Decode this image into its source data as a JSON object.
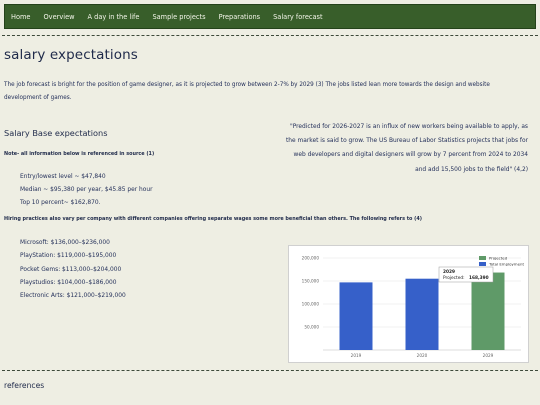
{
  "nav": {
    "items": [
      "Home",
      "Overview",
      "A day in the life",
      "Sample projects",
      "Preparations",
      "Salary forecast"
    ]
  },
  "page": {
    "title": "salary expectations",
    "intro": "The job forecast is bright for the position of game designer, as it is projected to grow between 2-7% by 2029 (3) The jobs listed lean more towards the design and website development of games."
  },
  "base": {
    "heading": "Salary Base expectations",
    "note": "Note- all information below is referenced in source (1)",
    "items": [
      "Entry/lowest level ~ $47,840",
      "Median ~ $95,380 per year, $45.85 per hour",
      "Top 10 percent~ $162,870."
    ]
  },
  "quote": "\"Predicted for 2026-2027 is an influx of new workers being available to apply, as the market is said to grow. The US Bureau of Labor Statistics projects that jobs for web developers and digital designers will grow by 7 percent from 2024 to 2034 and add 15,500 jobs to the field\" (4,2)",
  "hiring": {
    "text": "Hiring practices also vary per company with different companies offering separate wages some more beneficial than others. The following refers to (4)",
    "items": [
      "Microsoft: $136,000–$236,000",
      "PlayStation: $119,000–$195,000",
      "Pocket Gems: $113,000–$204,000",
      "Playstudios: $104,000–$186,000",
      "Electronic Arts: $121,000–$219,000"
    ]
  },
  "references": {
    "heading": "references"
  },
  "chart_data": {
    "type": "bar",
    "categories": [
      "2019",
      "2020",
      "2029"
    ],
    "series": [
      {
        "name": "Total Employment",
        "values": [
          147000,
          155000,
          0
        ],
        "color": "#3660c9"
      },
      {
        "name": "Projected",
        "values": [
          0,
          0,
          168390
        ],
        "color": "#5f9a68"
      }
    ],
    "ylim": [
      0,
      200000
    ],
    "yticks": [
      "50,000",
      "100,000",
      "150,000",
      "200,000"
    ],
    "ytick_values": [
      50000,
      100000,
      150000,
      200000
    ],
    "legend_position": "top-right",
    "grid": true,
    "tooltip": {
      "year": "2029",
      "label": "Projected:",
      "value": "168,390"
    }
  }
}
